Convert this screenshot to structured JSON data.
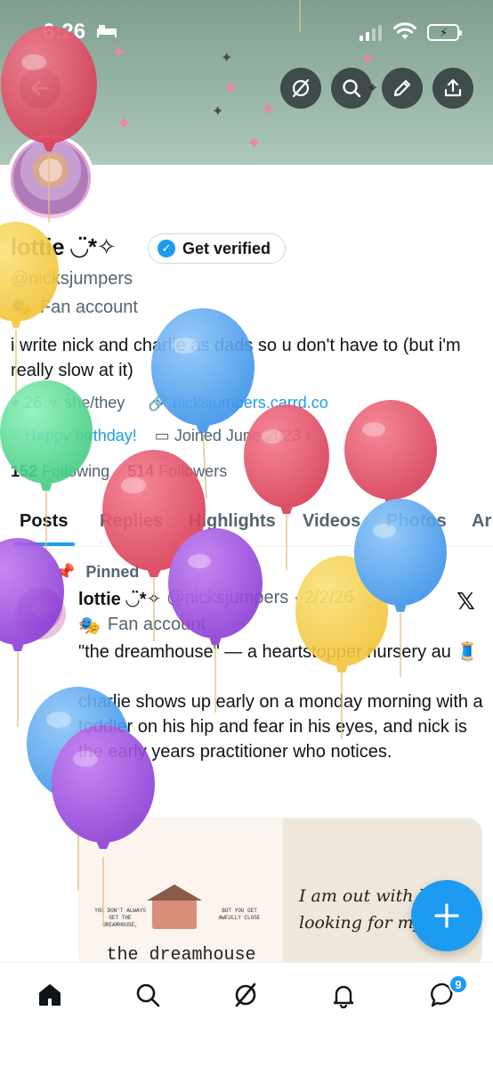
{
  "status_bar": {
    "time": "6:26"
  },
  "profile": {
    "name": "lottie ◡̈*✧",
    "verify_label": "Get verified",
    "handle": "@nicksjumpers",
    "category": "Fan account",
    "bio": "i write nick and charlie as dads so u don't have to (but i'm really slow at it)",
    "location": "26 ✧ she/they",
    "link": "nicksjumpers.carrd.co",
    "birthday": "Happy birthday!",
    "joined": "Joined June 2023",
    "following_count": "152",
    "following_label": "Following",
    "followers_count": "514",
    "followers_label": "Followers"
  },
  "tabs": [
    {
      "label": "Posts"
    },
    {
      "label": "Replies"
    },
    {
      "label": "Highlights"
    },
    {
      "label": "Videos"
    },
    {
      "label": "Photos"
    },
    {
      "label": "Ar"
    }
  ],
  "post": {
    "pinned_label": "Pinned",
    "author": "lottie ◡̈*✧",
    "handle_date": "@nicksjumpers · 2/2/26",
    "category": "Fan account",
    "paragraph1": "\"the dreamhouse\" — a heartstopper nursery au",
    "paragraph2": "charlie shows up early on a monday morning with a toddler on his hip and fear in his eyes, and nick is the early years practitioner who notices.",
    "media_left_small_1": "YOU DON'T ALWAYS GET THE DREAMHOUSE,",
    "media_left_small_2": "BUT YOU GET AWFULLY CLOSE",
    "media_left_title": "the dreamhouse",
    "media_right_line1": "I am out with la",
    "media_right_line2": "looking for myse"
  },
  "nav": {
    "messages_badge": "9"
  }
}
